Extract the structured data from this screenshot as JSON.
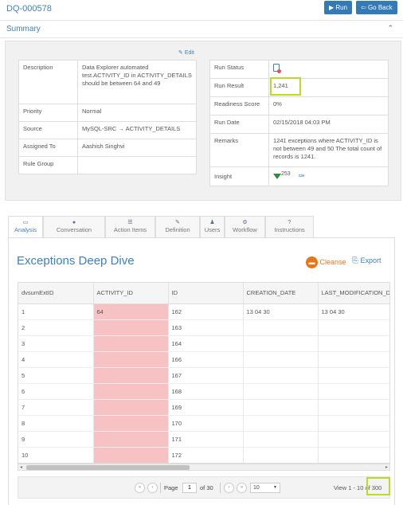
{
  "header": {
    "title": "DQ-000578",
    "run_label": "Run",
    "go_back_label": "Go Back"
  },
  "summary": {
    "label": "Summary",
    "edit_label": "Edit"
  },
  "details_left": [
    {
      "key": "Description",
      "value": "Data Explorer automated test.ACTIVITY_ID in ACTIVITY_DETAILS should be between 64 and 49"
    },
    {
      "key": "Priority",
      "value": "Normal"
    },
    {
      "key": "Source",
      "value": "MySQL-SRC → ACTIVITY_DETAILS"
    },
    {
      "key": "Assigned To",
      "value": "Aashish Singhvi"
    },
    {
      "key": "Rule Group",
      "value": ""
    }
  ],
  "details_right": {
    "run_status_key": "Run Status",
    "run_result_key": "Run Result",
    "run_result": "1,241",
    "readiness_key": "Readiness Score",
    "readiness": "0%",
    "run_date_key": "Run Date",
    "run_date": "02/15/2018 04:03 PM",
    "remarks_key": "Remarks",
    "remarks": "1241 exceptions where ACTIVITY_ID is not between 49 and 50 The total count of records is 1241.",
    "insight_key": "Insight",
    "insight_value": "253"
  },
  "tabs": [
    {
      "label": "Analysis",
      "icon": "analysis-icon",
      "glyph": "▭"
    },
    {
      "label": "Conversation",
      "icon": "chat-icon",
      "glyph": "●"
    },
    {
      "label": "Action Items",
      "icon": "list-icon",
      "glyph": "☰"
    },
    {
      "label": "Definition",
      "icon": "edit-icon",
      "glyph": "✎"
    },
    {
      "label": "Users",
      "icon": "user-icon",
      "glyph": "♟"
    },
    {
      "label": "Workflow",
      "icon": "gears-icon",
      "glyph": "⚙"
    },
    {
      "label": "Instructions",
      "icon": "question-icon",
      "glyph": "?"
    }
  ],
  "deep_dive": {
    "title": "Exceptions Deep Dive",
    "cleanse_label": "Cleanse",
    "export_label": "Export"
  },
  "grid": {
    "columns": [
      "dvsumExtID",
      "ACTIVITY_ID",
      "ID",
      "CREATION_DATE",
      "LAST_MODIFICATION_D"
    ],
    "rows": [
      [
        "1",
        "64",
        "162",
        "13 04 30",
        "13 04 30"
      ],
      [
        "2",
        "",
        "163",
        "",
        ""
      ],
      [
        "3",
        "",
        "164",
        "",
        ""
      ],
      [
        "4",
        "",
        "166",
        "",
        ""
      ],
      [
        "5",
        "",
        "167",
        "",
        ""
      ],
      [
        "6",
        "",
        "168",
        "",
        ""
      ],
      [
        "7",
        "",
        "169",
        "",
        ""
      ],
      [
        "8",
        "",
        "170",
        "",
        ""
      ],
      [
        "9",
        "",
        "171",
        "",
        ""
      ],
      [
        "10",
        "",
        "172",
        "",
        ""
      ]
    ]
  },
  "pager": {
    "page_label": "Page",
    "page_value": "1",
    "of_pages": "of 30",
    "page_size": "10",
    "view_text": "View 1 - 10 of 300"
  },
  "colors": {
    "accent": "#3d7fc1",
    "highlight_cell": "#f6c2c4",
    "annotation": "#b9dc2b",
    "cleanse": "#e8751a"
  }
}
